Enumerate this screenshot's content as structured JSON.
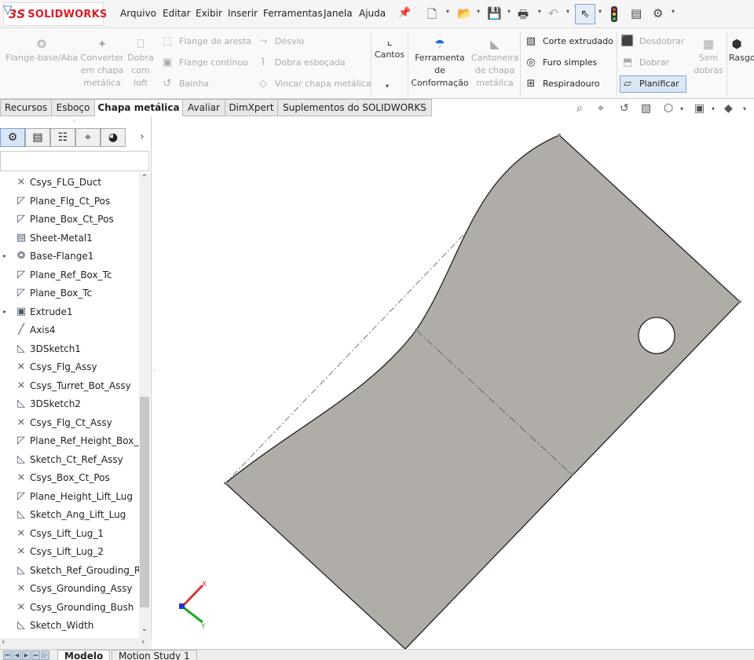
{
  "app": {
    "brand": "SOLIDWORKS",
    "logo_mark": "3S"
  },
  "menu": [
    "Arquivo",
    "Editar",
    "Exibir",
    "Inserir",
    "Ferramentas",
    "Janela",
    "Ajuda"
  ],
  "ribbon": {
    "flange_base": [
      "Flange-base/Aba"
    ],
    "converter": [
      "Converter",
      "em chapa",
      "metálica"
    ],
    "dobra_loft": [
      "Dobra",
      "com",
      "loft"
    ],
    "flange_aresta": "Flange de aresta",
    "flange_continuo": "Flange contínuo",
    "bainha": "Bainha",
    "desvio": "Desvio",
    "dobra_esbocada": "Dobra esboçada",
    "vincar": "Vincar chapa metálica",
    "cantos": "Cantos",
    "ferramenta": [
      "Ferramenta",
      "de",
      "Conformação"
    ],
    "cantoneira": [
      "Cantoneira",
      "de chapa",
      "metálica"
    ],
    "corte_extrudado": "Corte extrudado",
    "furo_simples": "Furo simples",
    "respiradouro": "Respiradouro",
    "desdobrar": "Desdobrar",
    "dobrar": "Dobrar",
    "planificar": "Planificar",
    "sem_dobras": [
      "Sem",
      "dobras"
    ],
    "rasgo": "Rasgo"
  },
  "tabs": [
    "Recursos",
    "Esboço",
    "Chapa metálica",
    "Avaliar",
    "DimXpert",
    "Suplementos do SOLIDWORKS"
  ],
  "active_tab": "Chapa metálica",
  "tree": [
    {
      "label": "Csys_FLG_Duct",
      "icon": "csys-icon"
    },
    {
      "label": "Plane_Flg_Ct_Pos",
      "icon": "plane-icon"
    },
    {
      "label": "Plane_Box_Ct_Pos",
      "icon": "plane-icon"
    },
    {
      "label": "Sheet-Metal1",
      "icon": "sheet-metal-icon"
    },
    {
      "label": "Base-Flange1",
      "icon": "base-flange-icon",
      "expandable": true
    },
    {
      "label": "Plane_Ref_Box_Tc",
      "icon": "plane-icon"
    },
    {
      "label": "Plane_Box_Tc",
      "icon": "plane-icon"
    },
    {
      "label": "Extrude1",
      "icon": "extrude-icon",
      "expandable": true
    },
    {
      "label": "Axis4",
      "icon": "axis-icon"
    },
    {
      "label": "3DSketch1",
      "icon": "sketch-icon"
    },
    {
      "label": "Csys_Flg_Assy",
      "icon": "csys-icon"
    },
    {
      "label": "Csys_Turret_Bot_Assy",
      "icon": "csys-icon"
    },
    {
      "label": "3DSketch2",
      "icon": "sketch-icon"
    },
    {
      "label": "Csys_Flg_Ct_Assy",
      "icon": "csys-icon"
    },
    {
      "label": "Plane_Ref_Height_Box_Ct",
      "icon": "plane-icon"
    },
    {
      "label": "Sketch_Ct_Ref_Assy",
      "icon": "sketch-icon"
    },
    {
      "label": "Csys_Box_Ct_Pos",
      "icon": "csys-icon"
    },
    {
      "label": "Plane_Height_Lift_Lug",
      "icon": "plane-icon"
    },
    {
      "label": "Sketch_Ang_Lift_Lug",
      "icon": "sketch-icon"
    },
    {
      "label": "Csys_Lift_Lug_1",
      "icon": "csys-icon"
    },
    {
      "label": "Csys_Lift_Lug_2",
      "icon": "csys-icon"
    },
    {
      "label": "Sketch_Ref_Grouding_Ro",
      "icon": "sketch-icon"
    },
    {
      "label": "Csys_Grounding_Assy",
      "icon": "csys-icon"
    },
    {
      "label": "Csys_Grounding_Bush",
      "icon": "csys-icon"
    },
    {
      "label": "Sketch_Width",
      "icon": "sketch-icon"
    }
  ],
  "bottom_tabs": [
    "Modelo",
    "Motion Study 1"
  ],
  "triad": {
    "x": "X",
    "y": "Y"
  },
  "colors": {
    "part_fill": "#b0ada8",
    "brand_red": "#d32027",
    "accent_blue": "#1a6fc9"
  }
}
